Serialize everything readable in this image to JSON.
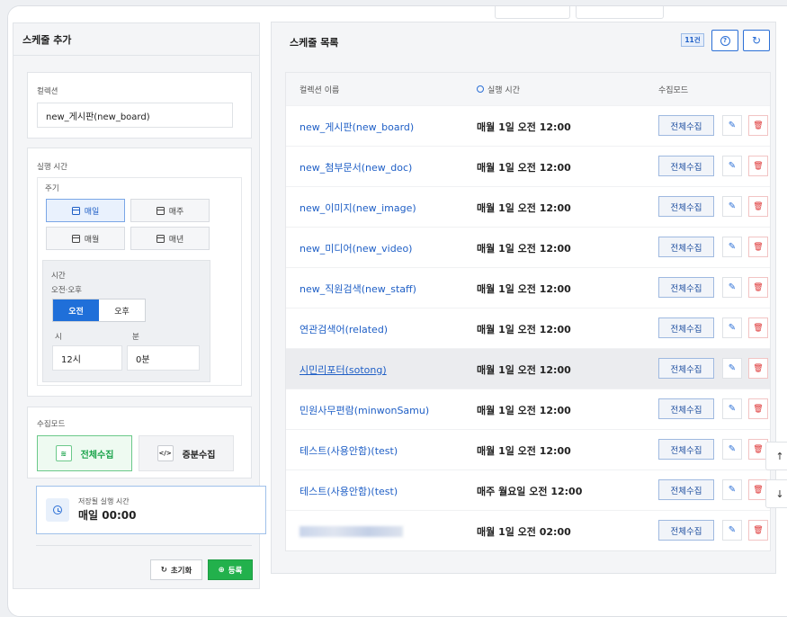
{
  "left": {
    "title": "스케줄 추가",
    "collection_label": "컬렉션",
    "collection_value": "new_게시판(new_board)",
    "run_time_label": "실행 시간",
    "cycle_label": "주기",
    "cycles": [
      "매일",
      "매주",
      "매월",
      "매년"
    ],
    "active_cycle": "매일",
    "time_label": "시간",
    "ampm_label": "오전·오후",
    "am": "오전",
    "pm": "오후",
    "hour_label": "시",
    "minute_label": "분",
    "hour_value": "12시",
    "minute_value": "0분",
    "mode_label": "수집모드",
    "mode_full": "전체수집",
    "mode_incremental": "증분수집",
    "summary_label": "저장될 실행 시간",
    "summary_value": "매일 00:00",
    "reset_label": "초기화",
    "register_label": "등록"
  },
  "right": {
    "title": "스케줄 목록",
    "count_badge": "11건",
    "col_name": "컬렉션 이름",
    "col_time": "실행 시간",
    "col_mode": "수집모드",
    "rows": [
      {
        "name": "new_게시판(new_board)",
        "time": "매월 1일 오전 12:00",
        "mode": "전체수집"
      },
      {
        "name": "new_첨부문서(new_doc)",
        "time": "매월 1일 오전 12:00",
        "mode": "전체수집"
      },
      {
        "name": "new_이미지(new_image)",
        "time": "매월 1일 오전 12:00",
        "mode": "전체수집"
      },
      {
        "name": "new_미디어(new_video)",
        "time": "매월 1일 오전 12:00",
        "mode": "전체수집"
      },
      {
        "name": "new_직원검색(new_staff)",
        "time": "매월 1일 오전 12:00",
        "mode": "전체수집"
      },
      {
        "name": "연관검색어(related)",
        "time": "매월 1일 오전 12:00",
        "mode": "전체수집"
      },
      {
        "name": "시민리포터(sotong)",
        "time": "매월 1일 오전 12:00",
        "mode": "전체수집"
      },
      {
        "name": "민원사무편람(minwonSamu)",
        "time": "매월 1일 오전 12:00",
        "mode": "전체수집"
      },
      {
        "name": "테스트(사용안함)(test)",
        "time": "매월 1일 오전 12:00",
        "mode": "전체수집"
      },
      {
        "name": "테스트(사용안함)(test)",
        "time": "매주 월요일 오전 12:00",
        "mode": "전체수집"
      },
      {
        "name": "",
        "time": "매월 1일 오전 02:00",
        "mode": "전체수집"
      }
    ]
  },
  "colors": {
    "accent": "#1f6fd9",
    "link": "#1f5fc6",
    "success": "#19a34a",
    "danger": "#d33333"
  },
  "icons": {
    "calendar": "calendar-icon",
    "clock": "clock-icon",
    "help": "help-icon",
    "refresh": "refresh-icon",
    "edit": "pencil-icon",
    "delete": "trash-icon",
    "up": "arrow-up-icon",
    "down": "arrow-down-icon"
  }
}
